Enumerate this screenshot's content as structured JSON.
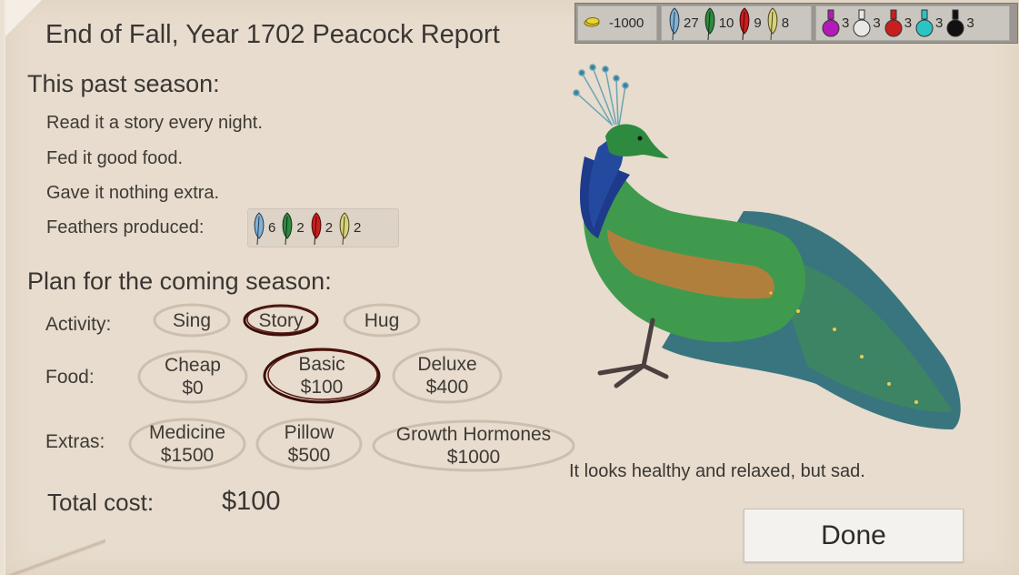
{
  "header": {
    "title": "End of Fall, Year 1702  Peacock Report"
  },
  "resources": {
    "money": "-1000",
    "feathers": [
      {
        "icon": "blue-feather-icon",
        "color": "#7fb2d6",
        "count": "27"
      },
      {
        "icon": "green-feather-icon",
        "color": "#2e8a3e",
        "count": "10"
      },
      {
        "icon": "red-feather-icon",
        "color": "#c81e1e",
        "count": "9"
      },
      {
        "icon": "yellow-feather-icon",
        "color": "#d8d27a",
        "count": "8"
      }
    ],
    "potions": [
      {
        "icon": "purple-potion-icon",
        "color": "#b31bb8",
        "count": "3"
      },
      {
        "icon": "white-potion-icon",
        "color": "#e8e8e8",
        "count": "3"
      },
      {
        "icon": "red-potion-icon",
        "color": "#c81e1e",
        "count": "3"
      },
      {
        "icon": "cyan-potion-icon",
        "color": "#2bc4c4",
        "count": "3"
      },
      {
        "icon": "black-potion-icon",
        "color": "#111111",
        "count": "3"
      }
    ]
  },
  "past": {
    "heading": "This past season:",
    "lines": [
      "Read it a story every night.",
      "Fed it good food.",
      "Gave it nothing extra."
    ],
    "feathers_label": "Feathers produced:",
    "feathers": [
      {
        "icon": "blue-feather-icon",
        "color": "#7fb2d6",
        "count": "6"
      },
      {
        "icon": "green-feather-icon",
        "color": "#2e8a3e",
        "count": "2"
      },
      {
        "icon": "red-feather-icon",
        "color": "#c81e1e",
        "count": "2"
      },
      {
        "icon": "yellow-feather-icon",
        "color": "#d8d27a",
        "count": "2"
      }
    ]
  },
  "plan": {
    "heading": "Plan for the coming season:",
    "activity": {
      "label": "Activity:",
      "options": [
        "Sing",
        "Story",
        "Hug"
      ],
      "selected": "Story"
    },
    "food": {
      "label": "Food:",
      "options": [
        {
          "name": "Cheap",
          "price": "$0"
        },
        {
          "name": "Basic",
          "price": "$100"
        },
        {
          "name": "Deluxe",
          "price": "$400"
        }
      ],
      "selected": "Basic"
    },
    "extras": {
      "label": "Extras:",
      "options": [
        {
          "name": "Medicine",
          "price": "$1500"
        },
        {
          "name": "Pillow",
          "price": "$500"
        },
        {
          "name": "Growth Hormones",
          "price": "$1000"
        }
      ],
      "selected": "none"
    },
    "total_label": "Total cost:",
    "total_value": "$100"
  },
  "status": "It looks healthy and relaxed, but sad.",
  "done_label": "Done",
  "colors": {
    "selected_ring": "#3a0f0a",
    "unselected_ring": "#cdbfb0",
    "accent": "#3a3633"
  }
}
